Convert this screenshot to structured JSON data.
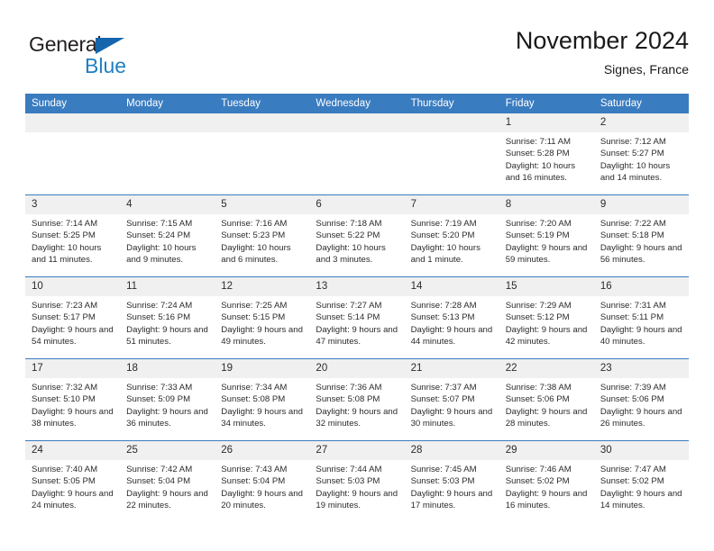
{
  "brand": {
    "name_part1": "General",
    "name_part2": "Blue",
    "triangle_color": "#1565ad",
    "blue_color": "#1f7fc4"
  },
  "header": {
    "title": "November 2024",
    "subtitle": "Signes, France"
  },
  "theme": {
    "header_blue": "#3a7cc0",
    "daynum_bg": "#f0f0f0",
    "text": "#2b2b2b"
  },
  "weekday_headers": [
    "Sunday",
    "Monday",
    "Tuesday",
    "Wednesday",
    "Thursday",
    "Friday",
    "Saturday"
  ],
  "weeks": [
    [
      {
        "day": "",
        "empty": true
      },
      {
        "day": "",
        "empty": true
      },
      {
        "day": "",
        "empty": true
      },
      {
        "day": "",
        "empty": true
      },
      {
        "day": "",
        "empty": true
      },
      {
        "day": "1",
        "sunrise": "Sunrise: 7:11 AM",
        "sunset": "Sunset: 5:28 PM",
        "daylight": "Daylight: 10 hours and 16 minutes."
      },
      {
        "day": "2",
        "sunrise": "Sunrise: 7:12 AM",
        "sunset": "Sunset: 5:27 PM",
        "daylight": "Daylight: 10 hours and 14 minutes."
      }
    ],
    [
      {
        "day": "3",
        "sunrise": "Sunrise: 7:14 AM",
        "sunset": "Sunset: 5:25 PM",
        "daylight": "Daylight: 10 hours and 11 minutes."
      },
      {
        "day": "4",
        "sunrise": "Sunrise: 7:15 AM",
        "sunset": "Sunset: 5:24 PM",
        "daylight": "Daylight: 10 hours and 9 minutes."
      },
      {
        "day": "5",
        "sunrise": "Sunrise: 7:16 AM",
        "sunset": "Sunset: 5:23 PM",
        "daylight": "Daylight: 10 hours and 6 minutes."
      },
      {
        "day": "6",
        "sunrise": "Sunrise: 7:18 AM",
        "sunset": "Sunset: 5:22 PM",
        "daylight": "Daylight: 10 hours and 3 minutes."
      },
      {
        "day": "7",
        "sunrise": "Sunrise: 7:19 AM",
        "sunset": "Sunset: 5:20 PM",
        "daylight": "Daylight: 10 hours and 1 minute."
      },
      {
        "day": "8",
        "sunrise": "Sunrise: 7:20 AM",
        "sunset": "Sunset: 5:19 PM",
        "daylight": "Daylight: 9 hours and 59 minutes."
      },
      {
        "day": "9",
        "sunrise": "Sunrise: 7:22 AM",
        "sunset": "Sunset: 5:18 PM",
        "daylight": "Daylight: 9 hours and 56 minutes."
      }
    ],
    [
      {
        "day": "10",
        "sunrise": "Sunrise: 7:23 AM",
        "sunset": "Sunset: 5:17 PM",
        "daylight": "Daylight: 9 hours and 54 minutes."
      },
      {
        "day": "11",
        "sunrise": "Sunrise: 7:24 AM",
        "sunset": "Sunset: 5:16 PM",
        "daylight": "Daylight: 9 hours and 51 minutes."
      },
      {
        "day": "12",
        "sunrise": "Sunrise: 7:25 AM",
        "sunset": "Sunset: 5:15 PM",
        "daylight": "Daylight: 9 hours and 49 minutes."
      },
      {
        "day": "13",
        "sunrise": "Sunrise: 7:27 AM",
        "sunset": "Sunset: 5:14 PM",
        "daylight": "Daylight: 9 hours and 47 minutes."
      },
      {
        "day": "14",
        "sunrise": "Sunrise: 7:28 AM",
        "sunset": "Sunset: 5:13 PM",
        "daylight": "Daylight: 9 hours and 44 minutes."
      },
      {
        "day": "15",
        "sunrise": "Sunrise: 7:29 AM",
        "sunset": "Sunset: 5:12 PM",
        "daylight": "Daylight: 9 hours and 42 minutes."
      },
      {
        "day": "16",
        "sunrise": "Sunrise: 7:31 AM",
        "sunset": "Sunset: 5:11 PM",
        "daylight": "Daylight: 9 hours and 40 minutes."
      }
    ],
    [
      {
        "day": "17",
        "sunrise": "Sunrise: 7:32 AM",
        "sunset": "Sunset: 5:10 PM",
        "daylight": "Daylight: 9 hours and 38 minutes."
      },
      {
        "day": "18",
        "sunrise": "Sunrise: 7:33 AM",
        "sunset": "Sunset: 5:09 PM",
        "daylight": "Daylight: 9 hours and 36 minutes."
      },
      {
        "day": "19",
        "sunrise": "Sunrise: 7:34 AM",
        "sunset": "Sunset: 5:08 PM",
        "daylight": "Daylight: 9 hours and 34 minutes."
      },
      {
        "day": "20",
        "sunrise": "Sunrise: 7:36 AM",
        "sunset": "Sunset: 5:08 PM",
        "daylight": "Daylight: 9 hours and 32 minutes."
      },
      {
        "day": "21",
        "sunrise": "Sunrise: 7:37 AM",
        "sunset": "Sunset: 5:07 PM",
        "daylight": "Daylight: 9 hours and 30 minutes."
      },
      {
        "day": "22",
        "sunrise": "Sunrise: 7:38 AM",
        "sunset": "Sunset: 5:06 PM",
        "daylight": "Daylight: 9 hours and 28 minutes."
      },
      {
        "day": "23",
        "sunrise": "Sunrise: 7:39 AM",
        "sunset": "Sunset: 5:06 PM",
        "daylight": "Daylight: 9 hours and 26 minutes."
      }
    ],
    [
      {
        "day": "24",
        "sunrise": "Sunrise: 7:40 AM",
        "sunset": "Sunset: 5:05 PM",
        "daylight": "Daylight: 9 hours and 24 minutes."
      },
      {
        "day": "25",
        "sunrise": "Sunrise: 7:42 AM",
        "sunset": "Sunset: 5:04 PM",
        "daylight": "Daylight: 9 hours and 22 minutes."
      },
      {
        "day": "26",
        "sunrise": "Sunrise: 7:43 AM",
        "sunset": "Sunset: 5:04 PM",
        "daylight": "Daylight: 9 hours and 20 minutes."
      },
      {
        "day": "27",
        "sunrise": "Sunrise: 7:44 AM",
        "sunset": "Sunset: 5:03 PM",
        "daylight": "Daylight: 9 hours and 19 minutes."
      },
      {
        "day": "28",
        "sunrise": "Sunrise: 7:45 AM",
        "sunset": "Sunset: 5:03 PM",
        "daylight": "Daylight: 9 hours and 17 minutes."
      },
      {
        "day": "29",
        "sunrise": "Sunrise: 7:46 AM",
        "sunset": "Sunset: 5:02 PM",
        "daylight": "Daylight: 9 hours and 16 minutes."
      },
      {
        "day": "30",
        "sunrise": "Sunrise: 7:47 AM",
        "sunset": "Sunset: 5:02 PM",
        "daylight": "Daylight: 9 hours and 14 minutes."
      }
    ]
  ]
}
